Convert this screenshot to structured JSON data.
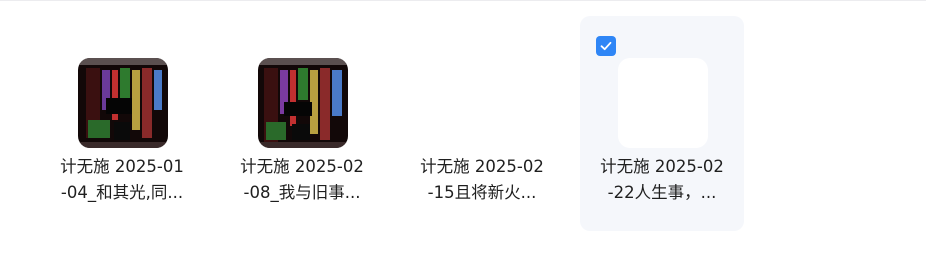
{
  "files": [
    {
      "line1": "计无施 2025-01",
      "line2": "-04_和其光,同...",
      "thumbnail": "spreadsheet-screenshot",
      "selected": false
    },
    {
      "line1": "计无施 2025-02",
      "line2": "-08_我与旧事...",
      "thumbnail": "spreadsheet-screenshot",
      "selected": false
    },
    {
      "line1": "计无施 2025-02",
      "line2": "-15且将新火...",
      "thumbnail": "none",
      "selected": false
    },
    {
      "line1": "计无施 2025-02",
      "line2": "-22人生事，...",
      "thumbnail": "blank",
      "selected": true
    }
  ],
  "colors": {
    "accent": "#2f86f6",
    "selected_bg": "#f5f7fb",
    "text": "#1f1f1f"
  }
}
